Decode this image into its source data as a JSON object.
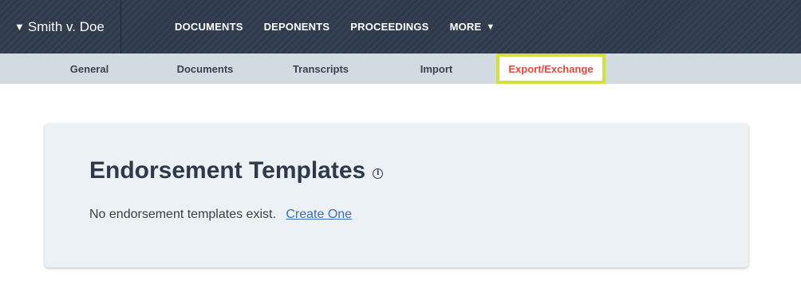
{
  "header": {
    "case_title": "Smith v. Doe",
    "case_caret": "▼",
    "nav": [
      {
        "label": "DOCUMENTS"
      },
      {
        "label": "DEPONENTS"
      },
      {
        "label": "PROCEEDINGS"
      },
      {
        "label": "MORE",
        "caret": "▼"
      }
    ]
  },
  "subnav": {
    "tabs": [
      {
        "label": "General"
      },
      {
        "label": "Documents"
      },
      {
        "label": "Transcripts"
      },
      {
        "label": "Import"
      },
      {
        "label": "Export/Exchange",
        "active": true
      }
    ],
    "active_color": "#e34a3c",
    "highlight_color": "#d4e03e"
  },
  "main": {
    "title": "Endorsement Templates",
    "info_icon": "info-icon",
    "empty_message": "No endorsement templates exist.",
    "create_link": "Create One"
  }
}
